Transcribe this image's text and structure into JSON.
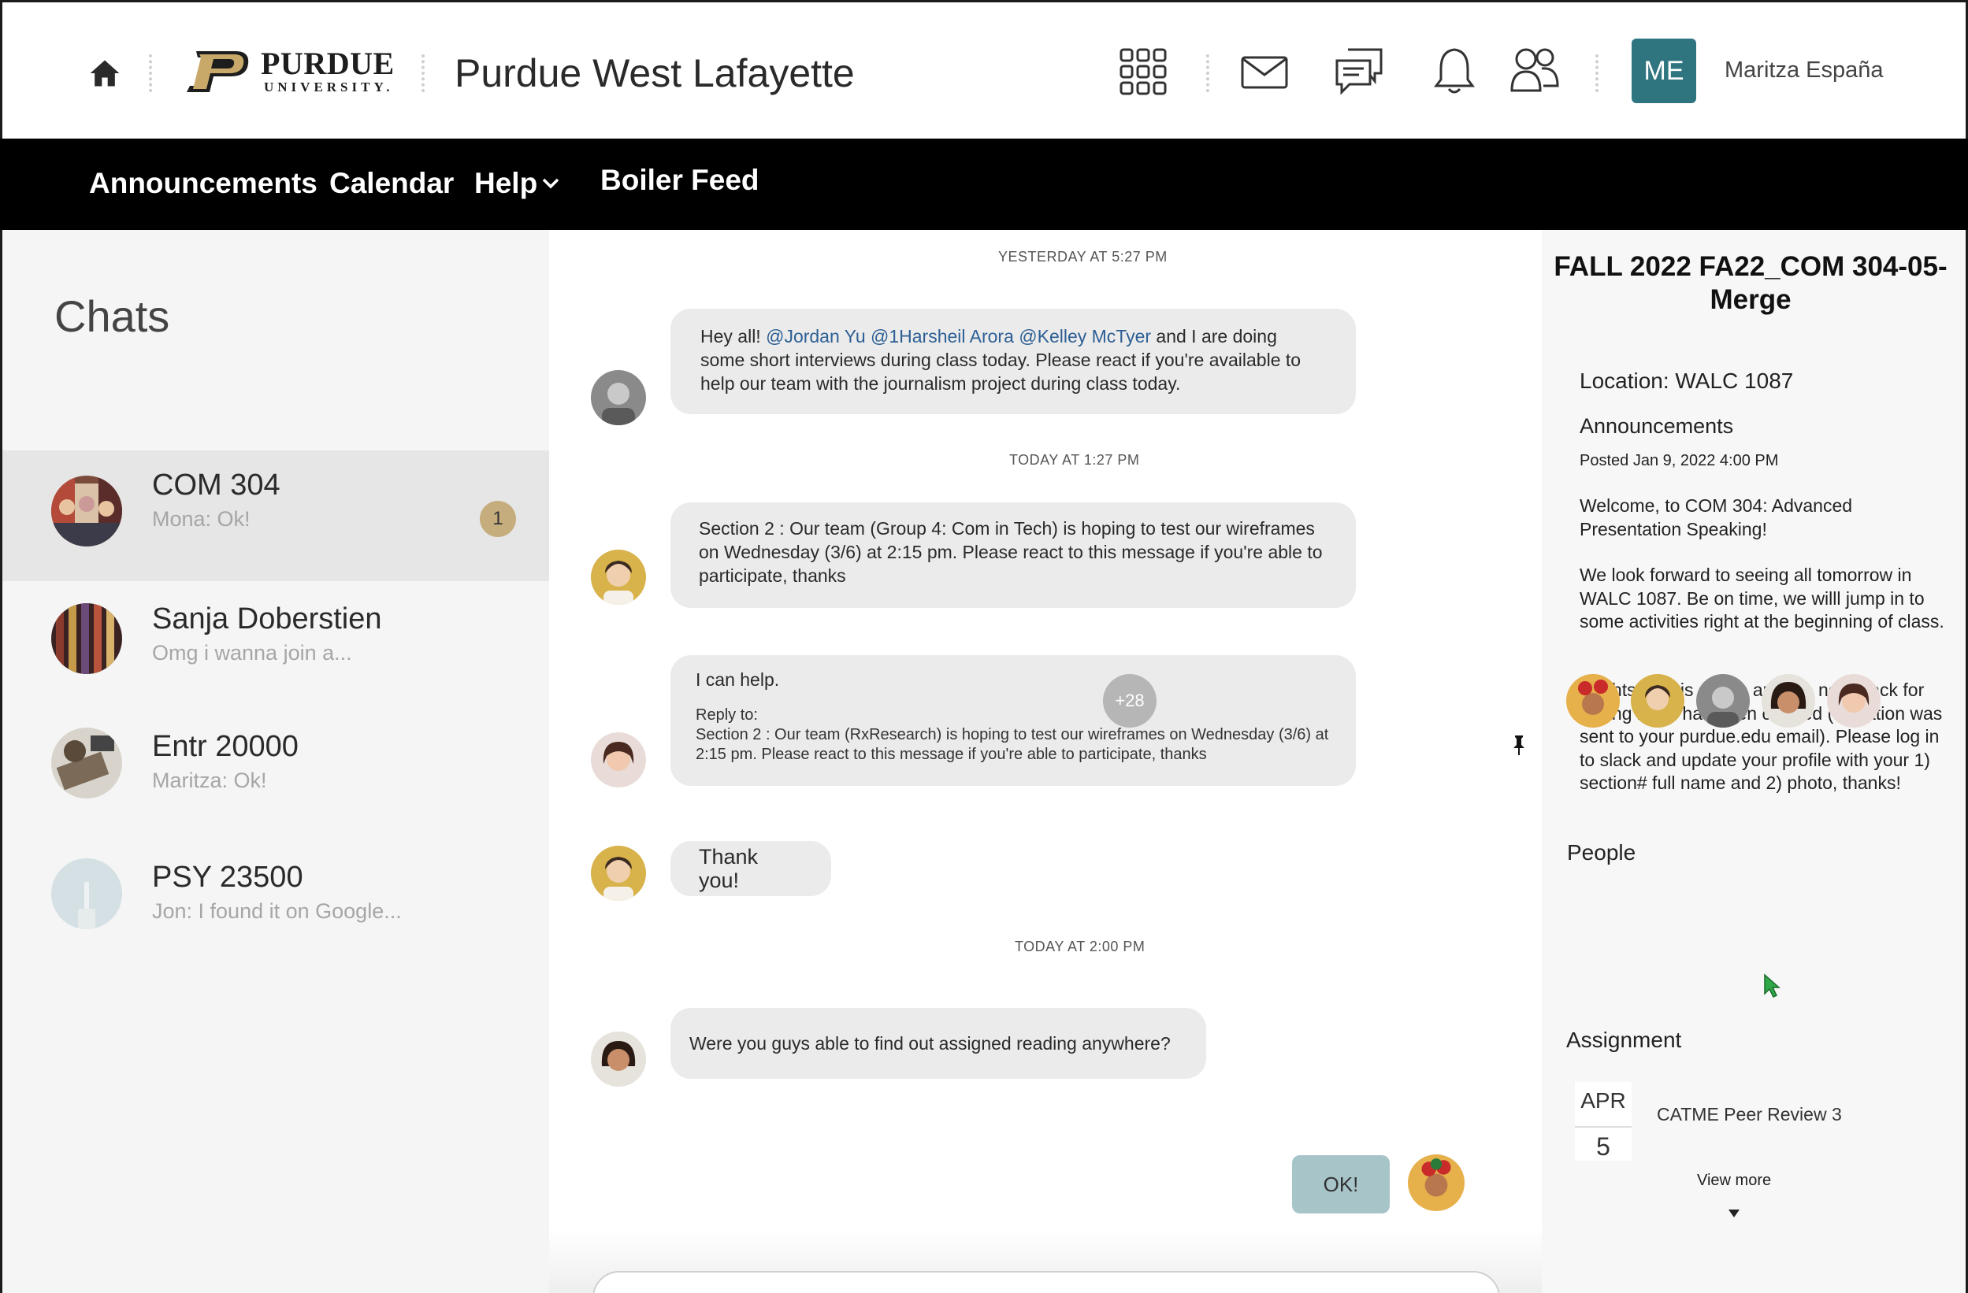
{
  "header": {
    "logo_word": "PURDUE",
    "logo_sub": "UNIVERSITY.",
    "site_title": "Purdue West Lafayette",
    "avatar_initials": "ME",
    "avatar_color": "#2f7580",
    "user_name": "Maritza España",
    "icons": [
      "home-icon",
      "apps-grid-icon",
      "mail-icon",
      "chat-icon",
      "bell-icon",
      "people-icon"
    ]
  },
  "nav": {
    "items": [
      {
        "label": "Announcements"
      },
      {
        "label": "Calendar"
      },
      {
        "label": "Help"
      },
      {
        "label": "Boiler Feed"
      }
    ]
  },
  "chats": {
    "title": "Chats",
    "items": [
      {
        "name": "COM 304",
        "preview": "Mona: Ok!",
        "unread": "1",
        "active": true
      },
      {
        "name": "Sanja Doberstien",
        "preview": "Omg i wanna join a..."
      },
      {
        "name": "Entr 20000",
        "preview": "Maritza: Ok!"
      },
      {
        "name": "PSY 23500",
        "preview": "Jon: I found it on Google..."
      }
    ]
  },
  "messages": {
    "timestamps": [
      "YESTERDAY AT 5:27 PM",
      "TODAY AT 1:27 PM",
      "TODAY AT 2:00 PM"
    ],
    "items": [
      {
        "pre": "Hey all! ",
        "mention": "@Jordan Yu @1Harsheil Arora @Kelley McTyer",
        "post": " and I are doing some short interviews during class today. Please react if you're available to help our team with the journalism project during class today."
      },
      {
        "text": "Section 2 : Our team (Group 4: Com in Tech) is hoping to test our wireframes on Wednesday (3/6) at 2:15 pm. Please react to this message if you're able to participate, thanks"
      },
      {
        "text": "I can help.",
        "reply_label": "Reply to:",
        "reply_text": "Section 2 : Our team (RxResearch) is hoping to test our wireframes on Wednesday (3/6) at 2:15 pm. Please react to this message if you're able to participate, thanks"
      },
      {
        "text": "Thank you!"
      },
      {
        "text": "Were you guys able to find out assigned reading anywhere?"
      }
    ],
    "sent": {
      "text": "OK!",
      "color": "#a7c4c8"
    }
  },
  "info": {
    "course_title": "FALL 2022 FA22_COM 304-05- Merge",
    "location": "Location: WALC 1087",
    "announcements_heading": "Announcements",
    "posted": "Posted Jan 9, 2022 4:00 PM",
    "para1": "Welcome, to COM 304: Advanced Presentation Speaking!",
    "para2": "We look forward to seeing all tomorrow in WALC 1087. Be on time, we willl jump in to some activities right at the beginning of class.",
    "para3": "Brightspace is set up and the new slack for Spring 2022  has been created (invitation was sent to your purdue.edu email).  Please log in to slack and update your profile with your 1) section# full name and 2) photo, thanks!",
    "people_heading": "People",
    "people_more": "+28",
    "assignment_heading": "Assignment",
    "assignment": {
      "month": "APR",
      "day": "5",
      "name": "CATME Peer Review 3"
    },
    "view_more": "View more"
  }
}
